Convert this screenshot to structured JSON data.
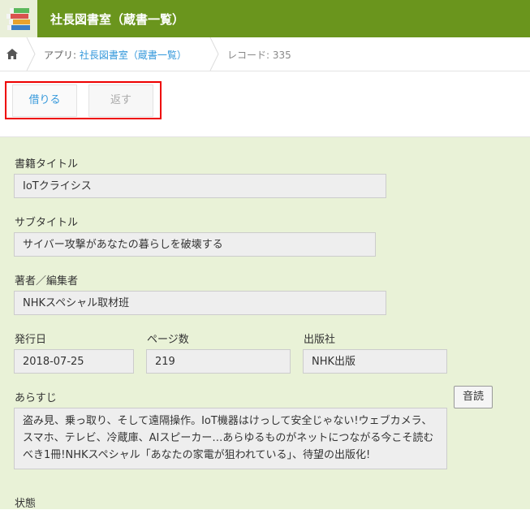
{
  "header": {
    "title": "社長図書室（蔵書一覧）",
    "logo_icon": "books-icon",
    "color": "#6a951d"
  },
  "breadcrumb": {
    "home_icon": "home-icon",
    "app_prefix": "アプリ: ",
    "app_name": "社長図書室（蔵書一覧）",
    "record": "レコード: 335"
  },
  "toolbar": {
    "borrow_label": "借りる",
    "return_label": "返す"
  },
  "fields": {
    "title_label": "書籍タイトル",
    "title_value": "IoTクライシス",
    "subtitle_label": "サブタイトル",
    "subtitle_value": "サイバー攻撃があなたの暮らしを破壊する",
    "author_label": "著者／編集者",
    "author_value": "NHKスペシャル取材班",
    "date_label": "発行日",
    "date_value": "2018-07-25",
    "pages_label": "ページ数",
    "pages_value": "219",
    "publisher_label": "出版社",
    "publisher_value": "NHK出版",
    "synopsis_label": "あらすじ",
    "synopsis_value": "盗み見、乗っ取り、そして遠隔操作。IoT機器はけっして安全じゃない!ウェブカメラ、スマホ、テレビ、冷蔵庫、AIスピーカー…あらゆるものがネットにつながる今こそ読むべき1冊!NHKスペシャル「あなたの家電が狙われている」、待望の出版化!",
    "read_aloud_label": "音読",
    "status_label": "状態"
  }
}
